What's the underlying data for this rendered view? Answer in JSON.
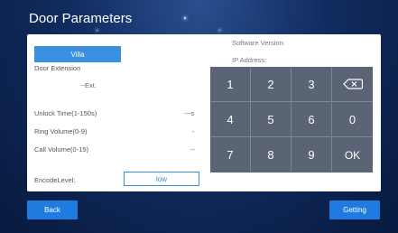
{
  "title": "Door Parameters",
  "buttons": {
    "villa": "Villa",
    "back": "Back",
    "getting": "Getting"
  },
  "info": {
    "software_version": "Software Version:",
    "ip_address": "IP Address:"
  },
  "fields": {
    "door_extension": {
      "label": "Door Extension",
      "value": "--Ext."
    },
    "unlock_time": {
      "label": "Unlock Time(1-150s)",
      "value": "---s"
    },
    "ring_volume": {
      "label": "Ring Volume(0-9)",
      "value": "-"
    },
    "call_volume": {
      "label": "Call Volume(0-15)",
      "value": "--"
    },
    "encode_level": {
      "label": "EncodeLevel:",
      "value": "low"
    }
  },
  "keypad": {
    "keys": [
      "1",
      "2",
      "3",
      "backspace",
      "4",
      "5",
      "6",
      "0",
      "7",
      "8",
      "9",
      "OK"
    ]
  },
  "colors": {
    "accent": "#1f7be0",
    "keypad": "#5a6474",
    "background": "#0b2350"
  }
}
